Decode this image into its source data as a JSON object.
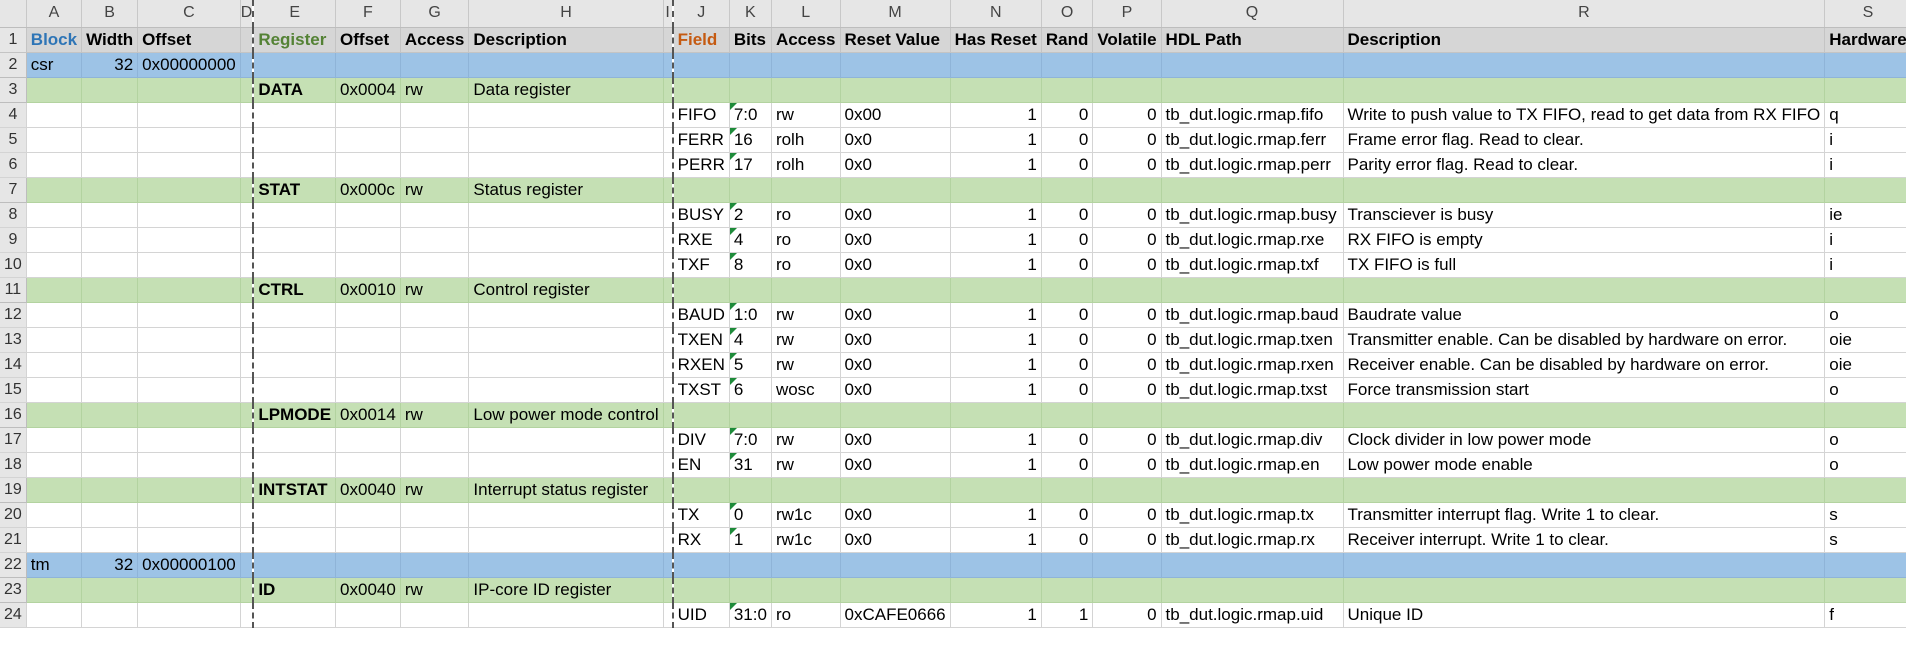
{
  "column_letters": [
    "A",
    "B",
    "C",
    "D",
    "E",
    "F",
    "G",
    "H",
    "I",
    "J",
    "K",
    "L",
    "M",
    "N",
    "O",
    "P",
    "Q",
    "R",
    "S"
  ],
  "rows": [
    {
      "kind": "titles",
      "cells": [
        "Block",
        "Width",
        "Offset",
        "",
        "Register",
        "Offset",
        "Access",
        "Description",
        "",
        "Field",
        "Bits",
        "Access",
        "Reset Value",
        "Has Reset",
        "Rand",
        "Volatile",
        "HDL Path",
        "Description",
        "Hardware"
      ]
    },
    {
      "kind": "block",
      "cells": [
        "csr",
        "32",
        "0x00000000",
        "",
        "",
        "",
        "",
        "",
        "",
        "",
        "",
        "",
        "",
        "",
        "",
        "",
        "",
        "",
        ""
      ]
    },
    {
      "kind": "reg",
      "cells": [
        "",
        "",
        "",
        "",
        "DATA",
        "0x0004",
        "rw",
        "Data register",
        "",
        "",
        "",
        "",
        "",
        "",
        "",
        "",
        "",
        "",
        ""
      ]
    },
    {
      "kind": "field",
      "cells": [
        "",
        "",
        "",
        "",
        "",
        "",
        "",
        "",
        "",
        "FIFO",
        "7:0",
        "rw",
        "0x00",
        "1",
        "0",
        "0",
        "tb_dut.logic.rmap.fifo",
        "Write to push value to TX FIFO, read to get data from RX FIFO",
        "q"
      ]
    },
    {
      "kind": "field",
      "cells": [
        "",
        "",
        "",
        "",
        "",
        "",
        "",
        "",
        "",
        "FERR",
        "16",
        "rolh",
        "0x0",
        "1",
        "0",
        "0",
        "tb_dut.logic.rmap.ferr",
        "Frame error flag. Read to clear.",
        "i"
      ]
    },
    {
      "kind": "field",
      "cells": [
        "",
        "",
        "",
        "",
        "",
        "",
        "",
        "",
        "",
        "PERR",
        "17",
        "rolh",
        "0x0",
        "1",
        "0",
        "0",
        "tb_dut.logic.rmap.perr",
        "Parity error flag. Read to clear.",
        "i"
      ]
    },
    {
      "kind": "reg",
      "cells": [
        "",
        "",
        "",
        "",
        "STAT",
        "0x000c",
        "rw",
        "Status register",
        "",
        "",
        "",
        "",
        "",
        "",
        "",
        "",
        "",
        "",
        ""
      ]
    },
    {
      "kind": "field",
      "cells": [
        "",
        "",
        "",
        "",
        "",
        "",
        "",
        "",
        "",
        "BUSY",
        "2",
        "ro",
        "0x0",
        "1",
        "0",
        "0",
        "tb_dut.logic.rmap.busy",
        "Transciever is busy",
        "ie"
      ]
    },
    {
      "kind": "field",
      "cells": [
        "",
        "",
        "",
        "",
        "",
        "",
        "",
        "",
        "",
        "RXE",
        "4",
        "ro",
        "0x0",
        "1",
        "0",
        "0",
        "tb_dut.logic.rmap.rxe",
        "RX FIFO is empty",
        "i"
      ]
    },
    {
      "kind": "field",
      "cells": [
        "",
        "",
        "",
        "",
        "",
        "",
        "",
        "",
        "",
        "TXF",
        "8",
        "ro",
        "0x0",
        "1",
        "0",
        "0",
        "tb_dut.logic.rmap.txf",
        "TX FIFO is full",
        "i"
      ]
    },
    {
      "kind": "reg",
      "cells": [
        "",
        "",
        "",
        "",
        "CTRL",
        "0x0010",
        "rw",
        "Control register",
        "",
        "",
        "",
        "",
        "",
        "",
        "",
        "",
        "",
        "",
        ""
      ]
    },
    {
      "kind": "field",
      "cells": [
        "",
        "",
        "",
        "",
        "",
        "",
        "",
        "",
        "",
        "BAUD",
        "1:0",
        "rw",
        "0x0",
        "1",
        "0",
        "0",
        "tb_dut.logic.rmap.baud",
        "Baudrate value",
        "o"
      ]
    },
    {
      "kind": "field",
      "cells": [
        "",
        "",
        "",
        "",
        "",
        "",
        "",
        "",
        "",
        "TXEN",
        "4",
        "rw",
        "0x0",
        "1",
        "0",
        "0",
        "tb_dut.logic.rmap.txen",
        "Transmitter enable. Can be disabled by hardware on error.",
        "oie"
      ]
    },
    {
      "kind": "field",
      "cells": [
        "",
        "",
        "",
        "",
        "",
        "",
        "",
        "",
        "",
        "RXEN",
        "5",
        "rw",
        "0x0",
        "1",
        "0",
        "0",
        "tb_dut.logic.rmap.rxen",
        "Receiver enable. Can be disabled by hardware on error.",
        "oie"
      ]
    },
    {
      "kind": "field",
      "cells": [
        "",
        "",
        "",
        "",
        "",
        "",
        "",
        "",
        "",
        "TXST",
        "6",
        "wosc",
        "0x0",
        "1",
        "0",
        "0",
        "tb_dut.logic.rmap.txst",
        "Force transmission start",
        "o"
      ]
    },
    {
      "kind": "reg",
      "cells": [
        "",
        "",
        "",
        "",
        "LPMODE",
        "0x0014",
        "rw",
        "Low power mode control",
        "",
        "",
        "",
        "",
        "",
        "",
        "",
        "",
        "",
        "",
        ""
      ]
    },
    {
      "kind": "field",
      "cells": [
        "",
        "",
        "",
        "",
        "",
        "",
        "",
        "",
        "",
        "DIV",
        "7:0",
        "rw",
        "0x0",
        "1",
        "0",
        "0",
        "tb_dut.logic.rmap.div",
        "Clock divider in low power mode",
        "o"
      ]
    },
    {
      "kind": "field",
      "cells": [
        "",
        "",
        "",
        "",
        "",
        "",
        "",
        "",
        "",
        "EN",
        "31",
        "rw",
        "0x0",
        "1",
        "0",
        "0",
        "tb_dut.logic.rmap.en",
        "Low power mode enable",
        "o"
      ]
    },
    {
      "kind": "reg",
      "cells": [
        "",
        "",
        "",
        "",
        "INTSTAT",
        "0x0040",
        "rw",
        "Interrupt status register",
        "",
        "",
        "",
        "",
        "",
        "",
        "",
        "",
        "",
        "",
        ""
      ]
    },
    {
      "kind": "field",
      "cells": [
        "",
        "",
        "",
        "",
        "",
        "",
        "",
        "",
        "",
        "TX",
        "0",
        "rw1c",
        "0x0",
        "1",
        "0",
        "0",
        "tb_dut.logic.rmap.tx",
        "Transmitter interrupt flag. Write 1 to clear.",
        "s"
      ]
    },
    {
      "kind": "field",
      "cells": [
        "",
        "",
        "",
        "",
        "",
        "",
        "",
        "",
        "",
        "RX",
        "1",
        "rw1c",
        "0x0",
        "1",
        "0",
        "0",
        "tb_dut.logic.rmap.rx",
        "Receiver interrupt. Write 1 to clear.",
        "s"
      ]
    },
    {
      "kind": "block",
      "cells": [
        "tm",
        "32",
        "0x00000100",
        "",
        "",
        "",
        "",
        "",
        "",
        "",
        "",
        "",
        "",
        "",
        "",
        "",
        "",
        "",
        ""
      ]
    },
    {
      "kind": "reg",
      "cells": [
        "",
        "",
        "",
        "",
        "ID",
        "0x0040",
        "rw",
        "IP-core ID register",
        "",
        "",
        "",
        "",
        "",
        "",
        "",
        "",
        "",
        "",
        ""
      ]
    },
    {
      "kind": "field",
      "cells": [
        "",
        "",
        "",
        "",
        "",
        "",
        "",
        "",
        "",
        "UID",
        "31:0",
        "ro",
        "0xCAFE0666",
        "1",
        "1",
        "0",
        "tb_dut.logic.rmap.uid",
        "Unique ID",
        "f"
      ]
    }
  ]
}
